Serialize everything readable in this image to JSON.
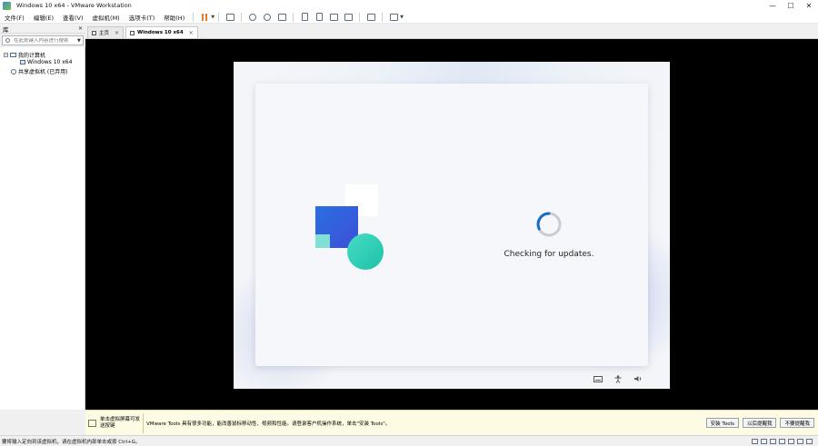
{
  "window": {
    "title": "Windows 10 x64 - VMware Workstation",
    "minimize": "—",
    "maximize": "☐",
    "close": "✕"
  },
  "menu": {
    "items": [
      "文件(F)",
      "编辑(E)",
      "查看(V)",
      "虚拟机(M)",
      "选项卡(T)",
      "帮助(H)"
    ]
  },
  "library": {
    "title": "库",
    "close": "✕",
    "search_placeholder": "在此处键入内容进行搜索",
    "tree": {
      "my_computer": "我的计算机",
      "vm": "Windows 10 x64",
      "shared": "共享虚拟机 (已弃用)"
    }
  },
  "tabs": [
    {
      "label": "主页",
      "close": "✕"
    },
    {
      "label": "Windows 10 x64",
      "close": "✕"
    }
  ],
  "guest": {
    "status": "Checking for updates.",
    "icons": [
      "keyboard-icon",
      "accessibility-icon",
      "volume-icon"
    ]
  },
  "notification": {
    "hint": "单击虚拟屏幕可发送按键",
    "message": "VMware Tools 具有很多功能，能改善鼠标移动性、视频和性能。请登录客户机操作系统，单击\"安装 Tools\"。",
    "buttons": [
      "安装 Tools",
      "以后提醒我",
      "不要提醒我"
    ]
  },
  "statusbar": {
    "text": "要将输入定向到该虚拟机，请在虚拟机内部单击或按 Ctrl+G。"
  },
  "colors": {
    "accent_blue": "#2a6fe0",
    "teal": "#1ec2a6",
    "pause_orange": "#e8772a",
    "notify_bg": "#fdfbe3"
  }
}
